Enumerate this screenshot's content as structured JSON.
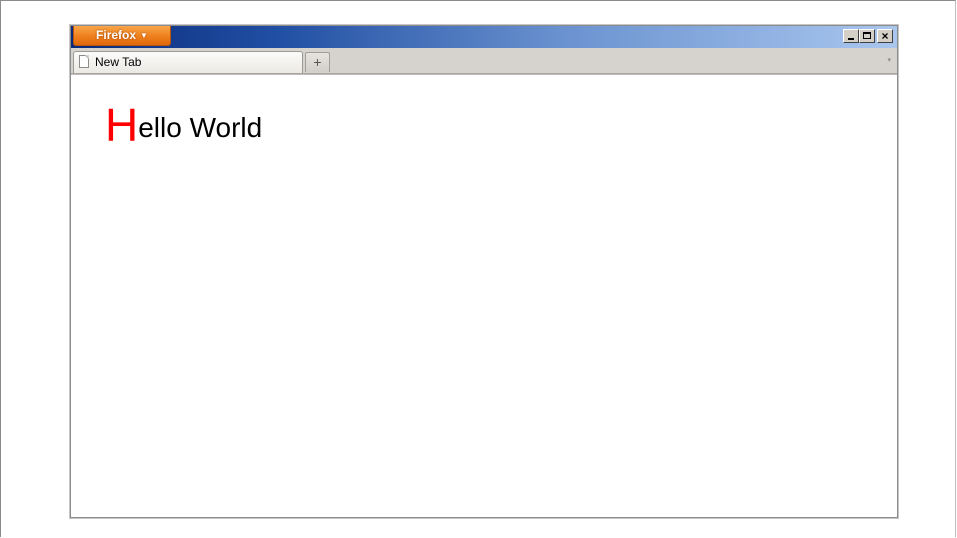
{
  "app_menu": {
    "label": "Firefox",
    "caret": "▼"
  },
  "window_controls": {
    "minimize_icon": "minimize-icon",
    "maximize_icon": "maximize-icon",
    "close_icon": "close-icon",
    "close_glyph": "×"
  },
  "tabs": [
    {
      "label": "New Tab",
      "icon": "blank-page-icon",
      "active": true
    }
  ],
  "new_tab_button": {
    "glyph": "+"
  },
  "tab_list_button": {
    "glyph": "▾"
  },
  "content": {
    "heading_first_letter": "H",
    "heading_rest": "ello World",
    "first_letter_color": "#ff0000"
  },
  "colors": {
    "app_button": "#ee7f1c",
    "titlebar_start": "#0a2a7a",
    "titlebar_end": "#a9c6ee",
    "chrome": "#d6d3ce"
  }
}
